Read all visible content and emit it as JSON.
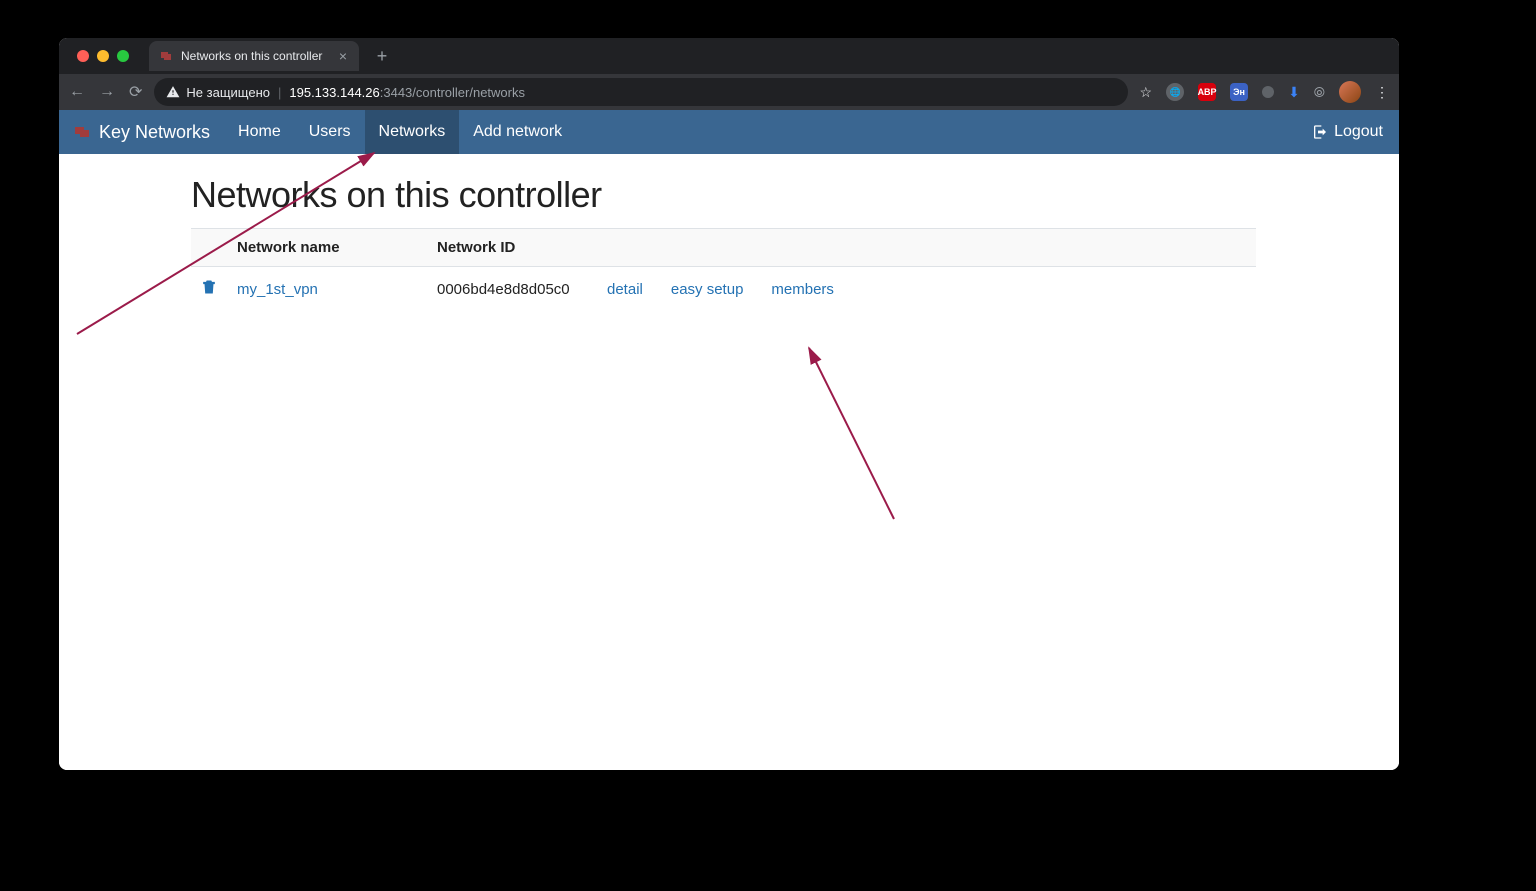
{
  "browser": {
    "tab_title": "Networks on this controller",
    "insecure_label": "Не защищено",
    "url_host": "195.133.144.26",
    "url_rest": ":3443/controller/networks"
  },
  "app_nav": {
    "brand": "Key Networks",
    "items": [
      "Home",
      "Users",
      "Networks",
      "Add network"
    ],
    "active_index": 2,
    "logout": "Logout"
  },
  "page": {
    "title": "Networks on this controller",
    "columns": {
      "name": "Network name",
      "id": "Network ID"
    },
    "rows": [
      {
        "name": "my_1st_vpn",
        "id": "0006bd4e8d8d05c0",
        "actions": {
          "detail": "detail",
          "easy_setup": "easy setup",
          "members": "members"
        }
      }
    ]
  }
}
